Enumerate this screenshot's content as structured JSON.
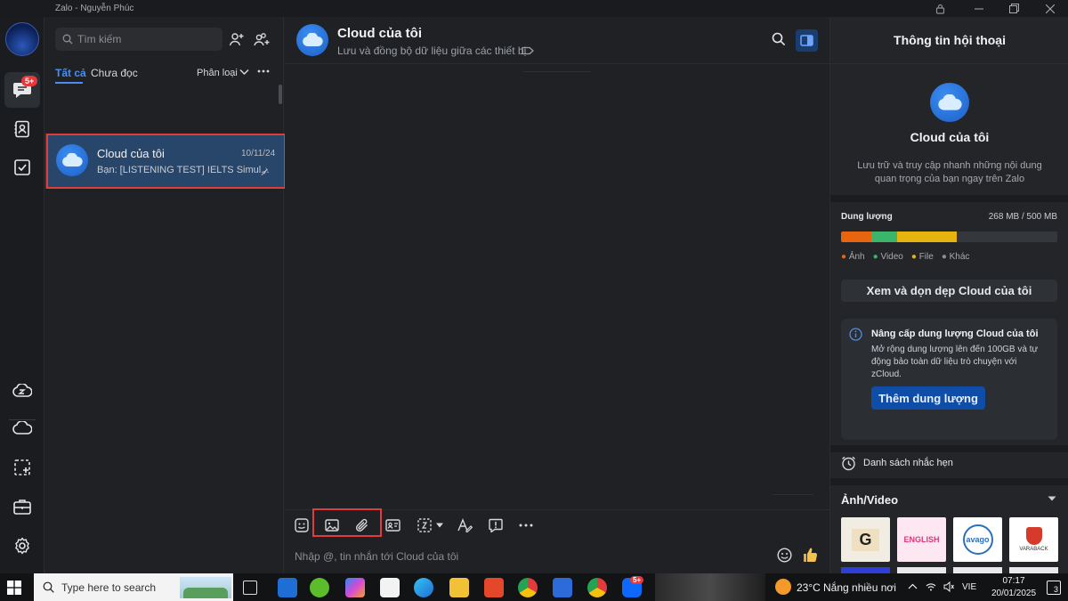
{
  "window": {
    "title": "Zalo - Nguyễn Phúc"
  },
  "rail": {
    "messages_badge": "5+"
  },
  "sidebar": {
    "search_placeholder": "Tìm kiếm",
    "tab_all": "Tất cả",
    "tab_unread": "Chưa đọc",
    "classify_label": "Phân loại"
  },
  "conversations": [
    {
      "name": "Cloud của tôi",
      "date": "10/11/24",
      "preview": "Bạn: [LISTENING TEST] IELTS Simul..."
    }
  ],
  "chat": {
    "title": "Cloud của tôi",
    "subtitle": "Lưu và đồng bộ dữ liệu giữa các thiết bị",
    "input_placeholder": "Nhập @, tin nhắn tới Cloud của tôi"
  },
  "info": {
    "header": "Thông tin hội thoại",
    "name": "Cloud của tôi",
    "description": "Lưu trữ và truy cập nhanh những nội dung quan trọng của bạn ngay trên Zalo",
    "storage_label": "Dung lượng",
    "storage_value": "268 MB / 500 MB",
    "storage_used_fraction": 0.536,
    "legend": [
      {
        "label": "Ảnh",
        "color": "#e8650f"
      },
      {
        "label": "Video",
        "color": "#3bb56a"
      },
      {
        "label": "File",
        "color": "#e6b40f"
      },
      {
        "label": "Khác",
        "color": "#8a8d92"
      }
    ],
    "cleanup_button": "Xem và dọn dẹp Cloud của tôi",
    "upgrade_title": "Nâng cấp dung lượng Cloud của tôi",
    "upgrade_body": "Mở rộng dung lượng lên đến 100GB và tự động bảo toàn dữ liệu trò chuyện với zCloud.",
    "upgrade_button": "Thêm dung lượng",
    "reminders": "Danh sách nhắc hẹn",
    "media_label": "Ảnh/Video"
  },
  "taskbar": {
    "search_placeholder": "Type here to search",
    "weather_temp": "23°C",
    "weather_text": "Nắng nhiều nơi",
    "lang": "VIE",
    "time": "07:17",
    "date": "20/01/2025",
    "notifications": "3",
    "zalo_badge": "5+"
  },
  "colors": {
    "accent": "#0f4ea8",
    "highlight": "#e23b3b",
    "selected": "#28456a"
  }
}
